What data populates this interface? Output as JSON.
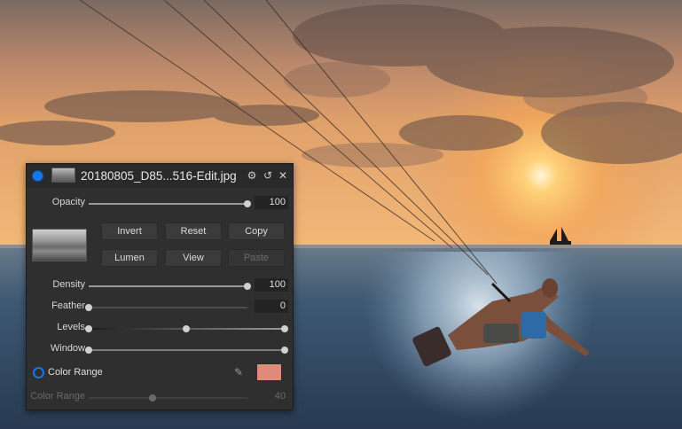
{
  "photo": {
    "description_icon": "kitesurfer-sunset-photo"
  },
  "panel": {
    "title": "20180805_D85...516-Edit.jpg",
    "icons": {
      "enable": "circle-toggle-icon",
      "settings": "gear-icon",
      "reset": "undo-icon",
      "close": "close-icon"
    },
    "opacity": {
      "label": "Opacity",
      "value": "100",
      "fraction": 1.0
    },
    "buttons": {
      "invert": "Invert",
      "reset": "Reset",
      "copy": "Copy",
      "lumen": "Lumen",
      "view": "View",
      "paste": "Paste"
    },
    "density": {
      "label": "Density",
      "value": "100",
      "fraction": 1.0
    },
    "feather": {
      "label": "Feather",
      "value": "0",
      "fraction": 0.0
    },
    "levels": {
      "label": "Levels",
      "low": 0.0,
      "mid": 0.5,
      "high": 1.0
    },
    "window": {
      "label": "Window",
      "low": 0.0,
      "high": 1.0
    },
    "color_range": {
      "toggle_label": "Color Range",
      "swatch_color": "#e08a7c",
      "slider_label": "Color Range",
      "value": "40",
      "fraction": 0.4
    }
  },
  "colors": {
    "accent": "#1877e8",
    "panel_bg": "#2f2f30"
  }
}
